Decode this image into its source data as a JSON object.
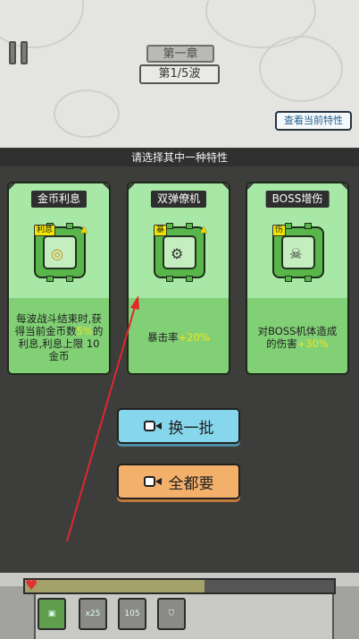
{
  "header": {
    "chapter": "第一章",
    "wave": "第1/5波",
    "view_traits": "查看当前特性"
  },
  "banner": "请选择其中一种特性",
  "cards": [
    {
      "title": "金币利息",
      "badge": "利息",
      "desc_before": "每波战斗结束时,获得当前金币数",
      "highlight": "5%",
      "desc_after": "的利息,利息上限 10金币",
      "icon": "coin-stack-icon"
    },
    {
      "title": "双弹僚机",
      "badge": "暴",
      "desc_before": "暴击率",
      "highlight": "+20%",
      "desc_after": "",
      "icon": "twin-cannon-icon"
    },
    {
      "title": "BOSS增伤",
      "badge": "伤",
      "desc_before": "对BOSS机体造成的伤害",
      "highlight": "+30%",
      "desc_after": "",
      "icon": "skull-target-icon"
    }
  ],
  "buttons": {
    "refresh": "换一批",
    "take_all": "全都要"
  },
  "hud": {
    "hp_fraction": 0.58,
    "slot_2": "x25",
    "slot_3": "105"
  },
  "colors": {
    "card_green": "#a7e8a6",
    "highlight": "#f3e31c",
    "refresh_blue": "#86d6ec",
    "take_all_orange": "#f3b06b"
  }
}
